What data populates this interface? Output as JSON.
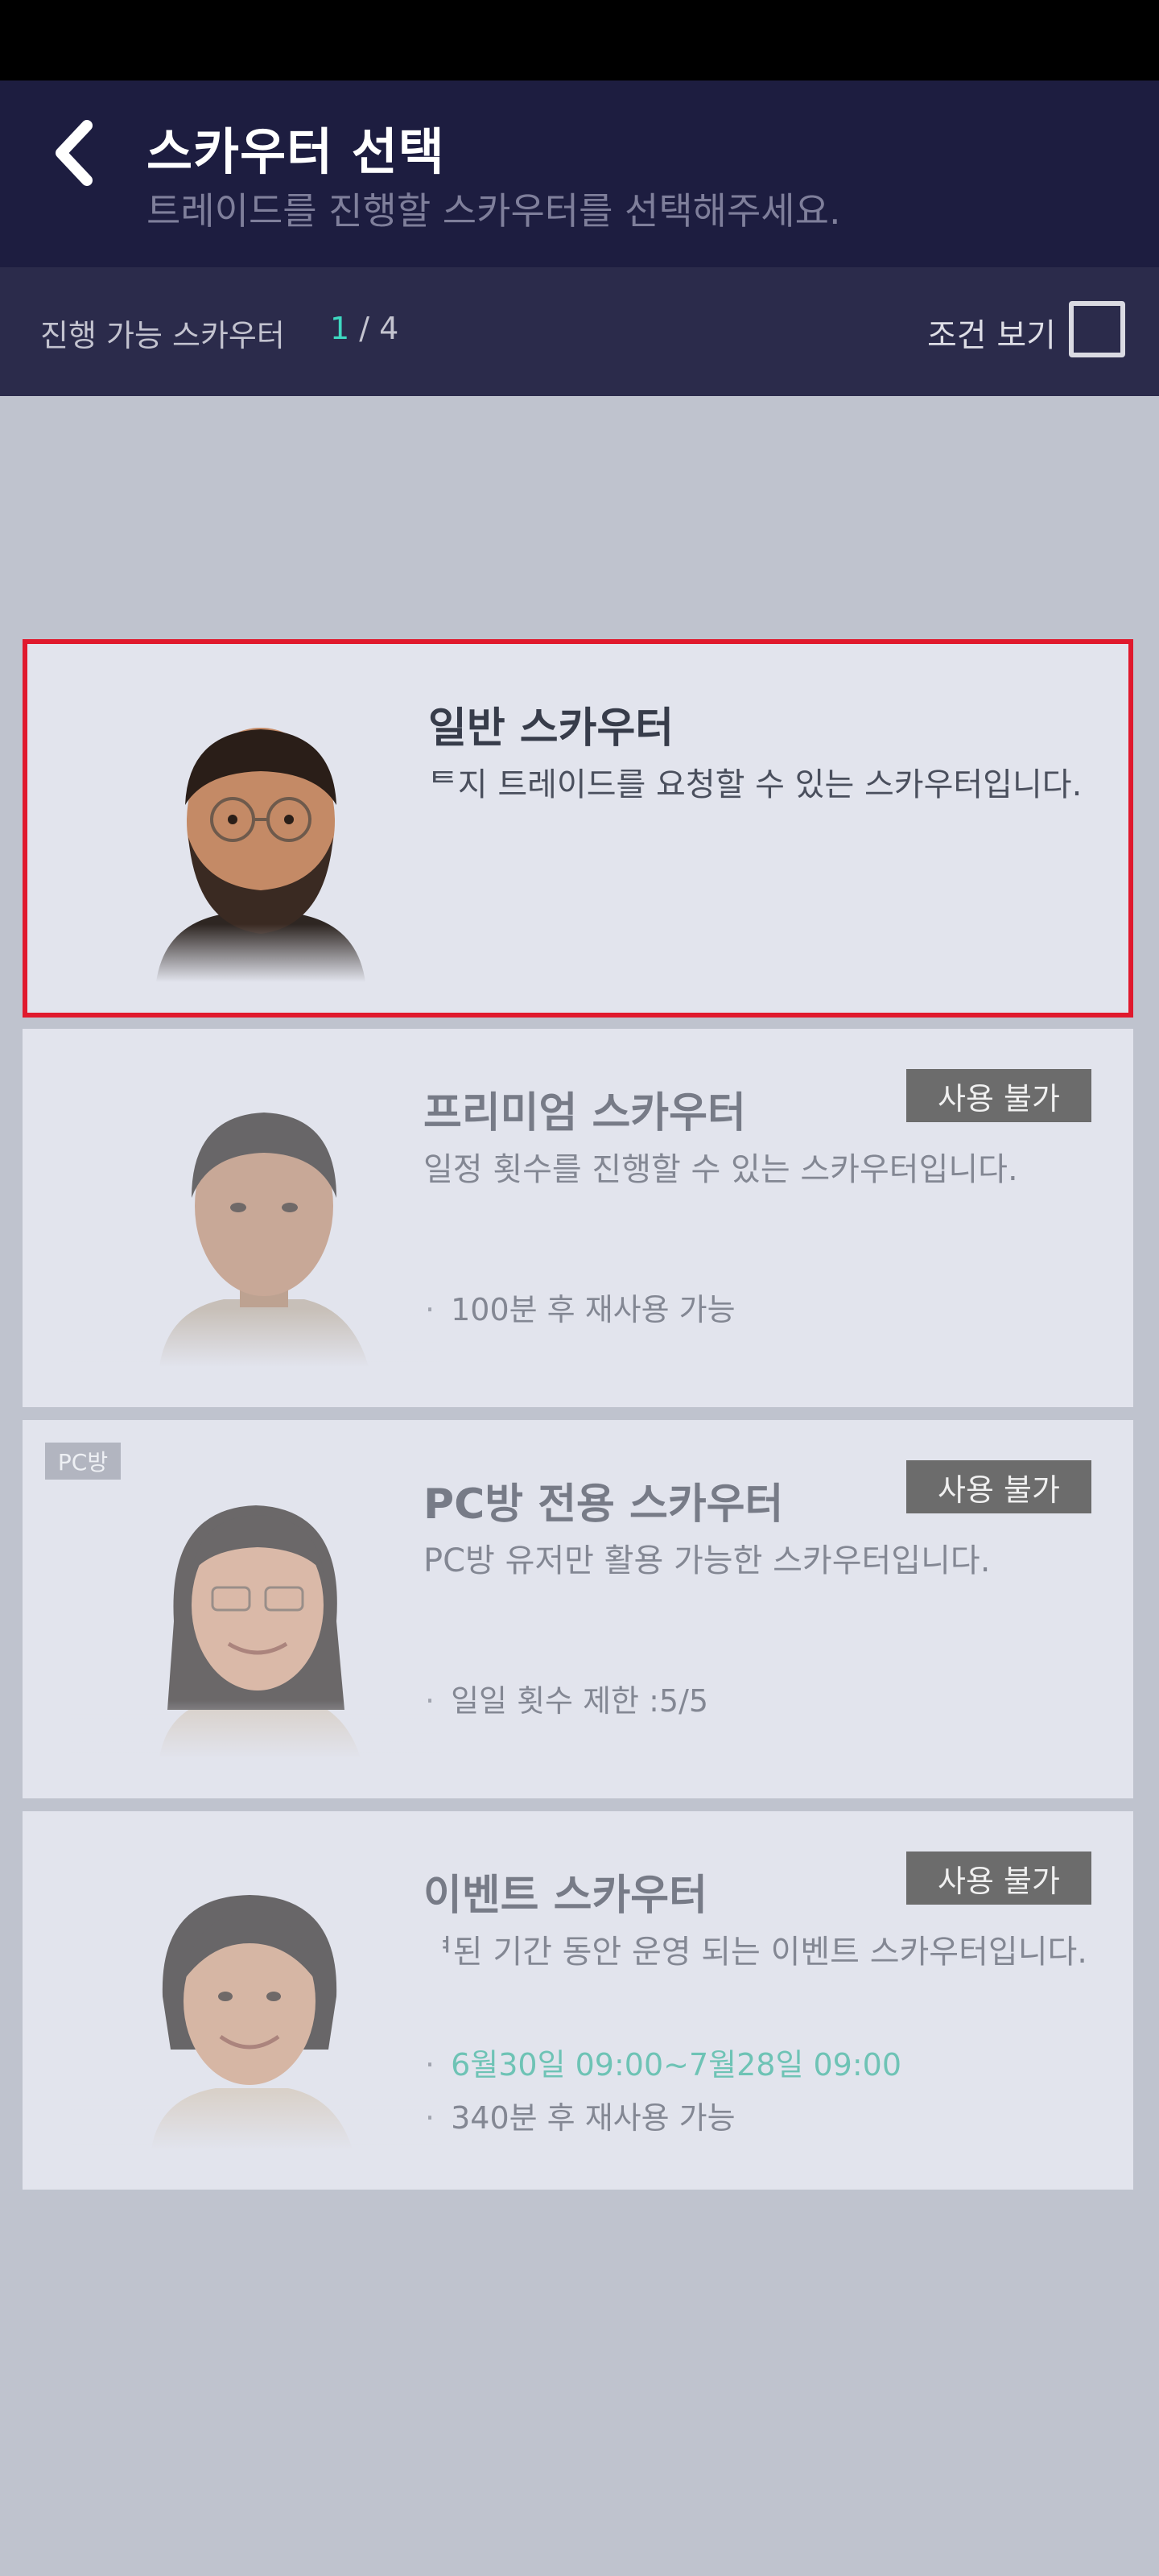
{
  "header": {
    "title": "스카우터 선택",
    "subtitle": "트레이드를 진행할 스카우터를 선택해주세요."
  },
  "filter": {
    "label": "진행 가능 스카우터",
    "current": "1",
    "separator": " / ",
    "total": "4",
    "condition_label": "조건 보기"
  },
  "cards": [
    {
      "title": "일반 스카우터",
      "desc": "ᄐ지 트레이드를 요청할 수 있는 스카우터입니다."
    },
    {
      "title": "프리미엄 스카우터",
      "desc": "일정 횟수를 진행할 수 있는 스카우터입니다.",
      "badge": "사용 불가",
      "info": "100분 후 재사용 가능"
    },
    {
      "title": "PC방 전용 스카우터",
      "desc": "PC방 유저만 활용 가능한 스카우터입니다.",
      "badge": "사용 불가",
      "tag": "PC방",
      "info": "일일 횟수 제한 :5/5"
    },
    {
      "title": "이벤트 스카우터",
      "desc": "ᅧ된 기간 동안 운영 되는 이벤트 스카우터입니다.",
      "badge": "사용 불가",
      "period": "6월30일 09:00~7월28일 09:00",
      "info": "340분 후 재사용 가능"
    }
  ],
  "colors": {
    "header_bg": "#1d1d40",
    "filter_bg": "#2b2b4b",
    "accent_count": "#3ed8c0",
    "selected_border": "#e0192d",
    "period_green": "#28b094"
  }
}
